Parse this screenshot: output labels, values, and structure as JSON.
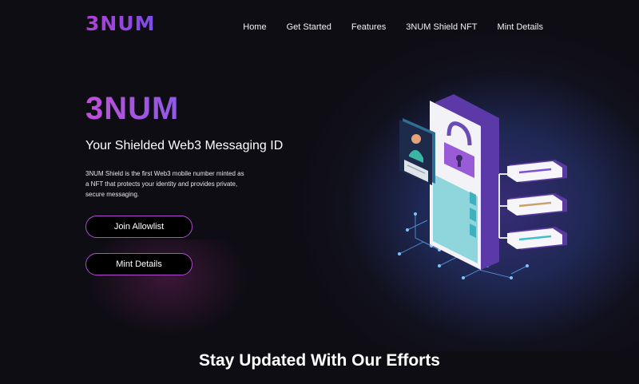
{
  "brand": {
    "logo_text": "3NUM"
  },
  "nav": {
    "items": [
      {
        "label": "Home"
      },
      {
        "label": "Get Started"
      },
      {
        "label": "Features"
      },
      {
        "label": "3NUM Shield NFT"
      },
      {
        "label": "Mint Details"
      }
    ]
  },
  "hero": {
    "title": "3NUM",
    "subtitle": "Your Shielded Web3 Messaging ID",
    "description": "3NUM Shield is the first Web3 mobile number minted as a NFT that protects your identity and provides private, secure messaging.",
    "primary_button": "Join Allowlist",
    "secondary_button": "Mint Details"
  },
  "section": {
    "title": "Stay Updated With Our Efforts"
  },
  "colors": {
    "accent_start": "#c04fd8",
    "accent_end": "#8e5ae8",
    "background": "#0f0d14",
    "button_border": "#b24ad6"
  },
  "icons": [
    "logo-icon",
    "lock-icon",
    "user-card-icon",
    "message-bubble-icon"
  ]
}
